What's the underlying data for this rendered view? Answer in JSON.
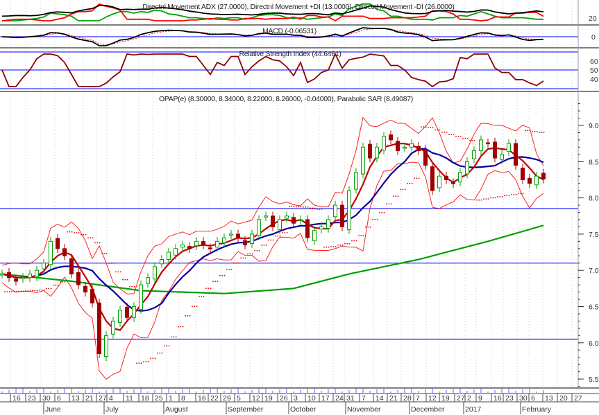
{
  "chart_data": {
    "type": "candlestick",
    "symbol_title": "OPAP(e) (8.30000, 8.34000, 8.22000, 8.26000, -0.04000), Parabolic SAR (8.49087)",
    "adx_title": "Directnl Movement ADX (27.0000), Directnl Movement +DI (13.0000), Directnl Movement -DI (26.0000)",
    "macd_title": "MACD (-0.06531)",
    "rsi_title": "Relative Strength Index (44.6461)",
    "ylim": [
      5.4,
      9.3
    ],
    "y_ticks": [
      "9.0",
      "8.5",
      "8.0",
      "7.5",
      "7.0",
      "6.5",
      "6.0",
      "5.5"
    ],
    "y_tick_values": [
      9.0,
      8.5,
      8.0,
      7.5,
      7.0,
      6.5,
      6.0,
      5.5
    ],
    "adx_ticks": [
      "20"
    ],
    "macd_ticks": [
      "0"
    ],
    "rsi_ticks": [
      "60",
      "50",
      "40"
    ],
    "rsi_tick_values": [
      60,
      50,
      40
    ],
    "horizontal_levels": [
      7.85,
      7.1,
      6.05
    ],
    "day_ticks": [
      "16",
      "23",
      "30",
      "6",
      "13",
      "21",
      "27",
      "4",
      "11",
      "18",
      "25",
      "1",
      "8",
      "16",
      "22",
      "29",
      "5",
      "12",
      "19",
      "26",
      "3",
      "10",
      "17",
      "24",
      "31",
      "7",
      "14",
      "21",
      "28",
      "7",
      "12",
      "19",
      "27",
      "2",
      "9",
      "16",
      "23",
      "30",
      "6",
      "13",
      "20",
      "27"
    ],
    "month_labels": [
      "June",
      "July",
      "August",
      "September",
      "October",
      "November",
      "December",
      "2017",
      "February"
    ],
    "close": [
      6.95,
      6.9,
      6.85,
      6.9,
      6.95,
      7.0,
      7.1,
      7.4,
      7.3,
      7.2,
      6.95,
      6.8,
      6.7,
      6.55,
      5.85,
      6.1,
      6.3,
      6.45,
      6.35,
      6.5,
      6.8,
      6.9,
      7.05,
      7.15,
      7.25,
      7.3,
      7.35,
      7.3,
      7.4,
      7.35,
      7.3,
      7.4,
      7.45,
      7.5,
      7.45,
      7.35,
      7.5,
      7.7,
      7.75,
      7.6,
      7.7,
      7.75,
      7.65,
      7.7,
      7.45,
      7.55,
      7.6,
      7.7,
      7.9,
      7.6,
      8.1,
      8.35,
      8.7,
      8.55,
      8.7,
      8.85,
      8.8,
      8.65,
      8.7,
      8.75,
      8.65,
      8.45,
      8.1,
      8.3,
      8.25,
      8.2,
      8.35,
      8.5,
      8.65,
      8.8,
      8.75,
      8.55,
      8.6,
      8.75,
      8.45,
      8.25,
      8.2,
      8.3,
      8.26
    ],
    "sma_long": [
      [
        0,
        6.95
      ],
      [
        10,
        6.85
      ],
      [
        20,
        6.72
      ],
      [
        32,
        6.68
      ],
      [
        42,
        6.75
      ],
      [
        50,
        6.95
      ],
      [
        60,
        7.15
      ],
      [
        70,
        7.4
      ],
      [
        78,
        7.62
      ]
    ],
    "colors": {
      "up": "#00a000",
      "down": "#a00000",
      "sma_short": "#c00000",
      "sma_mid": "#0000a0",
      "sma_long": "#00a000",
      "bands": "#ff2020",
      "sar": "#e00000",
      "level": "#3030ff"
    }
  }
}
